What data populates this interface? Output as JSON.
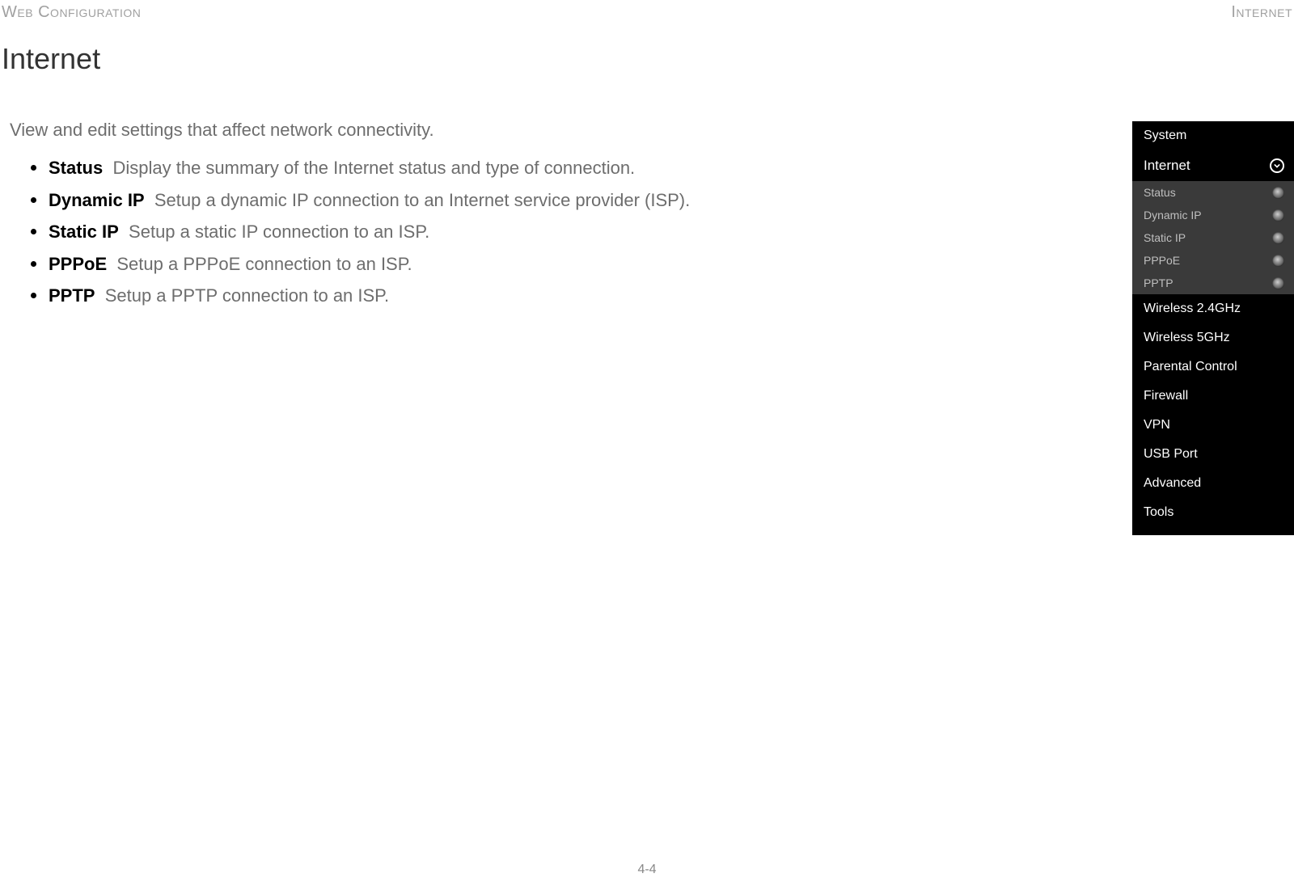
{
  "header": {
    "left": "Web Configuration",
    "right": "Internet"
  },
  "title": "Internet",
  "intro": "View and edit settings that affect network connectivity.",
  "features": [
    {
      "term": "Status",
      "desc": "Display the summary of the Internet status and type of connection."
    },
    {
      "term": "Dynamic IP",
      "desc": "Setup a dynamic IP connection to an Internet service provider (ISP)."
    },
    {
      "term": "Static IP",
      "desc": "Setup a static IP connection to an ISP."
    },
    {
      "term": "PPPoE",
      "desc": "Setup a PPPoE connection to an ISP."
    },
    {
      "term": "PPTP",
      "desc": "Setup a PPTP connection to an ISP."
    }
  ],
  "sidebar": {
    "items": [
      {
        "label": "System",
        "type": "top"
      },
      {
        "label": "Internet",
        "type": "active"
      },
      {
        "label": "Status",
        "type": "sub"
      },
      {
        "label": "Dynamic IP",
        "type": "sub"
      },
      {
        "label": "Static IP",
        "type": "sub"
      },
      {
        "label": "PPPoE",
        "type": "sub"
      },
      {
        "label": "PPTP",
        "type": "sub"
      },
      {
        "label": "Wireless 2.4GHz",
        "type": "top"
      },
      {
        "label": "Wireless 5GHz",
        "type": "top"
      },
      {
        "label": "Parental Control",
        "type": "top"
      },
      {
        "label": "Firewall",
        "type": "top"
      },
      {
        "label": "VPN",
        "type": "top"
      },
      {
        "label": "USB Port",
        "type": "top"
      },
      {
        "label": "Advanced",
        "type": "top"
      },
      {
        "label": "Tools",
        "type": "top"
      }
    ]
  },
  "page_number": "4-4"
}
